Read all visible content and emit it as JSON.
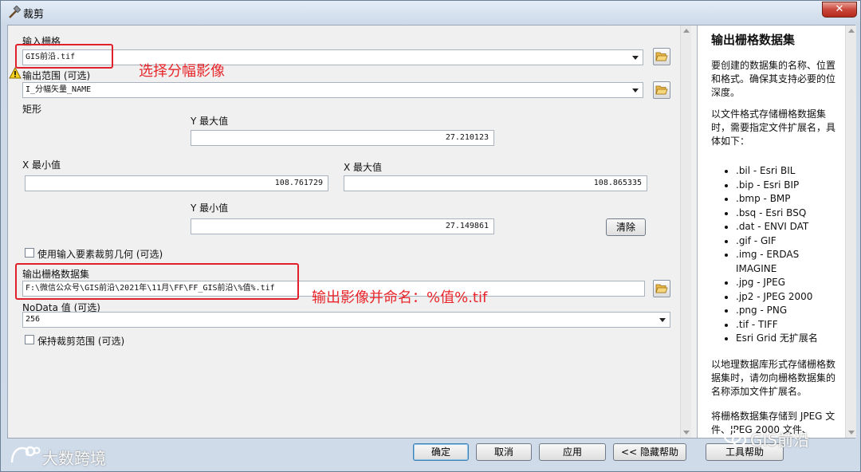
{
  "window": {
    "title": "裁剪",
    "close_label": "✕"
  },
  "form": {
    "input_raster_label": "输入栅格",
    "input_raster_value": "GIS前沿.tif",
    "extent_label": "输出范围 (可选)",
    "extent_value": "I_分幅矢量_NAME",
    "rectangle_label": "矩形",
    "ymax_label": "Y 最大值",
    "ymax_value": "27.210123",
    "xmin_label": "X 最小值",
    "xmin_value": "108.761729",
    "xmax_label": "X 最大值",
    "xmax_value": "108.865335",
    "ymin_label": "Y 最小值",
    "ymin_value": "27.149861",
    "clear_label": "清除",
    "use_geometry_label": "使用输入要素裁剪几何 (可选)",
    "output_label": "输出栅格数据集",
    "output_value": "F:\\微信公众号\\GIS前沿\\2021年\\11月\\FF\\FF_GIS前沿\\%值%.tif",
    "nodata_label": "NoData 值 (可选)",
    "nodata_value": "256",
    "maintain_extent_label": "保持裁剪范围 (可选)"
  },
  "annotations": {
    "select_raster": "选择分幅影像",
    "output_name": "输出影像并命名：%值%.tif"
  },
  "help": {
    "title": "输出栅格数据集",
    "p1": "要创建的数据集的名称、位置和格式。确保其支持必要的位深度。",
    "p2": "以文件格式存储栅格数据集时，需要指定文件扩展名，具体如下：",
    "formats": [
      ".bil - Esri BIL",
      ".bip - Esri BIP",
      ".bmp - BMP",
      ".bsq - Esri BSQ",
      ".dat - ENVI DAT",
      ".gif - GIF",
      ".img - ERDAS IMAGINE",
      ".jpg - JPEG",
      ".jp2 - JPEG 2000",
      ".png - PNG",
      ".tif - TIFF",
      "Esri Grid 无扩展名"
    ],
    "p3": "以地理数据库形式存储栅格数据集时，请勿向栅格数据集的名称添加文件扩展名。",
    "p4": "将栅格数据集存储到 JPEG 文件、JPEG 2000 文件、"
  },
  "buttons": {
    "ok": "确定",
    "cancel": "取消",
    "apply": "应用",
    "hide_help": "<< 隐藏帮助",
    "tool_help": "工具帮助"
  },
  "watermarks": {
    "left": "大数跨境",
    "right": "GIS前沿"
  }
}
